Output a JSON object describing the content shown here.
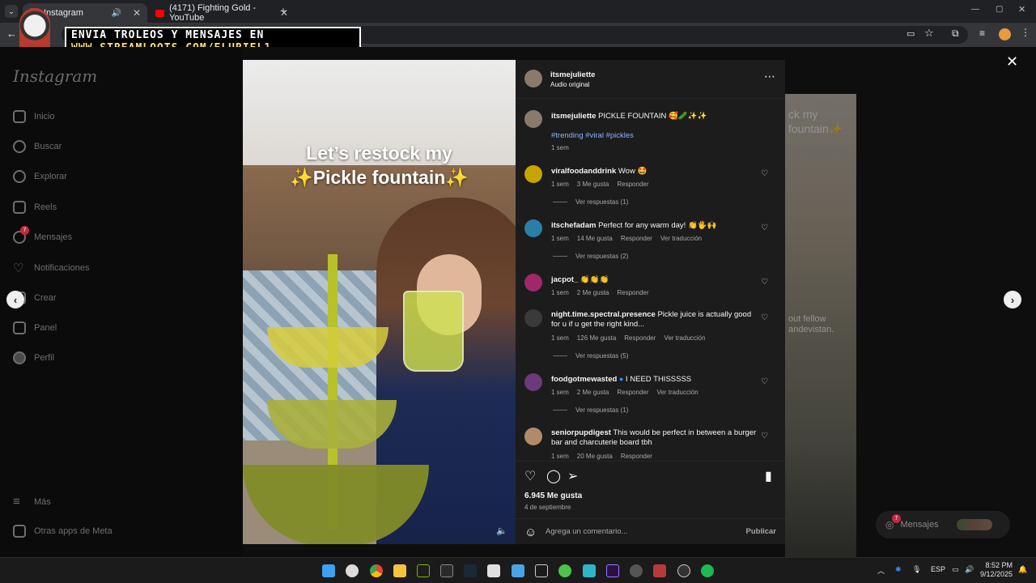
{
  "browser": {
    "tabs": [
      {
        "title": "Instagram",
        "active": true
      },
      {
        "title": "(4171) Fighting Gold - YouTube",
        "active": false
      }
    ],
    "new_tab": "+"
  },
  "overlay": {
    "line1": "ENVIA TROLEOS Y MENSAJES EN",
    "line2": "WWW.STREAMLOOTS.COM/ELURIEL1"
  },
  "sidebar": {
    "logo": "Instagram",
    "items": [
      {
        "label": "Inicio",
        "icon": "home-icon"
      },
      {
        "label": "Buscar",
        "icon": "search-icon"
      },
      {
        "label": "Explorar",
        "icon": "compass-icon"
      },
      {
        "label": "Reels",
        "icon": "reels-icon"
      },
      {
        "label": "Mensajes",
        "icon": "messenger-icon",
        "badge": "7"
      },
      {
        "label": "Notificaciones",
        "icon": "heart-icon"
      },
      {
        "label": "Crear",
        "icon": "plus-square-icon"
      },
      {
        "label": "Panel",
        "icon": "chart-icon"
      },
      {
        "label": "Perfil",
        "icon": "avatar-icon"
      }
    ],
    "bottom": [
      {
        "label": "Más",
        "icon": "menu-icon"
      },
      {
        "label": "Otras apps de Meta",
        "icon": "meta-apps-icon"
      }
    ]
  },
  "post": {
    "caption_overlay_line1": "Let’s restock my",
    "caption_overlay_line2": "✨Pickle fountain✨",
    "author": "itsmejuliette",
    "audio": "Audio original",
    "description": {
      "user": "itsmejuliette",
      "text": "PICKLE FOUNTAIN 🥰🥒✨✨",
      "tags": "#trending #viral #pickles",
      "time": "1 sem"
    },
    "comments": [
      {
        "user": "viralfoodanddrink",
        "text": "Wow 🤩",
        "time": "1 sem",
        "likes": "3 Me gusta",
        "reply": "Responder",
        "translate": "",
        "view_replies": "Ver respuestas (1)"
      },
      {
        "user": "itschefadam",
        "text": "Perfect for any warm day! 👏🖐🙌",
        "time": "1 sem",
        "likes": "14 Me gusta",
        "reply": "Responder",
        "translate": "Ver traducción",
        "view_replies": "Ver respuestas (2)"
      },
      {
        "user": "jacpot_",
        "text": "👏👏👏",
        "time": "1 sem",
        "likes": "2 Me gusta",
        "reply": "Responder",
        "translate": "",
        "view_replies": ""
      },
      {
        "user": "night.time.spectral.presence",
        "text": "Pickle juice is actually good for u if u get the right kind...",
        "time": "1 sem",
        "likes": "126 Me gusta",
        "reply": "Responder",
        "translate": "Ver traducción",
        "view_replies": "Ver respuestas (5)"
      },
      {
        "user": "foodgotmewasted",
        "text": "I NEED THISSSSS",
        "time": "1 sem",
        "likes": "2 Me gusta",
        "reply": "Responder",
        "translate": "Ver traducción",
        "view_replies": "Ver respuestas (1)"
      },
      {
        "user": "seniorpupdigest",
        "text": "This would be perfect in between a burger bar and charcuterie board tbh",
        "time": "1 sem",
        "likes": "20 Me gusta",
        "reply": "Responder",
        "translate": "",
        "view_replies": ""
      }
    ],
    "likes": "6.945 Me gusta",
    "date": "4 de septiembre",
    "comment_placeholder": "Agrega un comentario...",
    "publish": "Publicar"
  },
  "side_preview": {
    "text1": "ck my\nfountain✨",
    "text2": "out fellow\nandevistan."
  },
  "messages_pill": {
    "label": "Mensajes",
    "badge": "7"
  },
  "taskbar": {
    "lang": "ESP",
    "time": "8:52 PM",
    "date": "9/12/2025"
  }
}
